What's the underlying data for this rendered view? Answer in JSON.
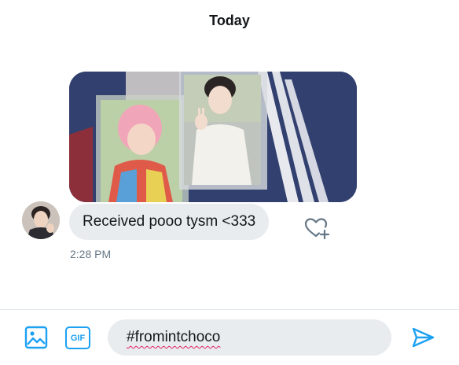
{
  "conversation": {
    "date_header": "Today"
  },
  "messages": [
    {
      "type": "image",
      "icon": "photocard-photo"
    },
    {
      "type": "text",
      "text": "Received pooo tysm <333",
      "timestamp": "2:28 PM"
    }
  ],
  "icons": {
    "avatar": "user-avatar-photo",
    "react": "heart-plus-icon",
    "media": "image-icon",
    "send": "send-icon"
  },
  "composer": {
    "gif_label": "GIF",
    "input_value": "#fromintchoco"
  },
  "colors": {
    "accent": "#1da1f2",
    "bubble": "#e9ecef",
    "timestamp": "#657786",
    "spellcheck": "#e0245e"
  }
}
